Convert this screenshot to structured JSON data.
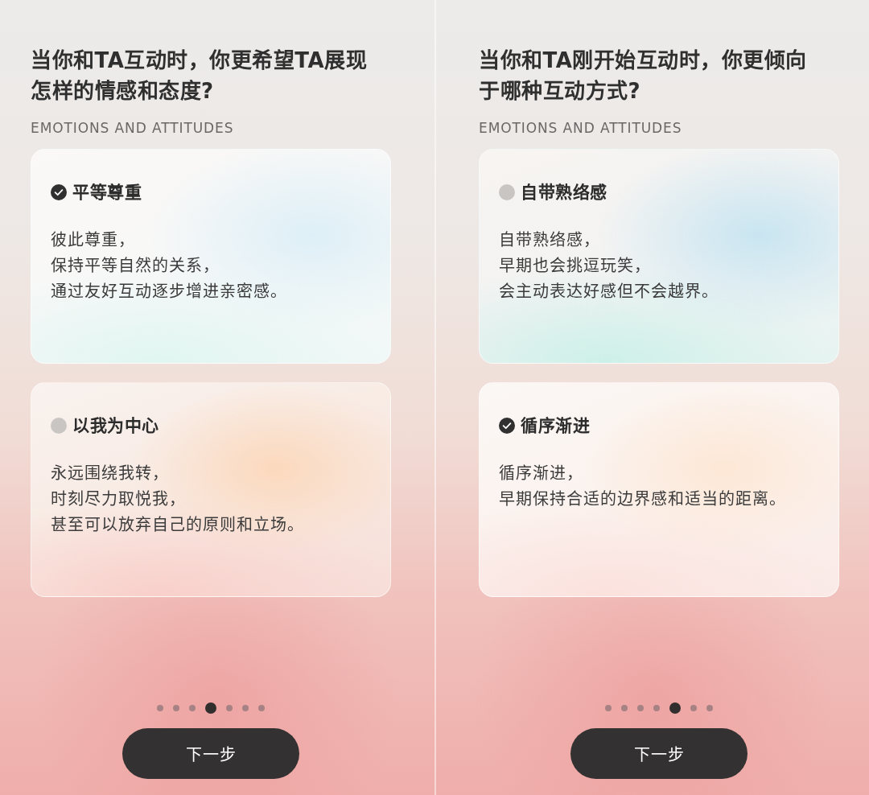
{
  "screens": [
    {
      "question": "当你和TA互动时，你更希望TA展现怎样的情感和态度?",
      "subtitle": "EMOTIONS AND ATTITUDES",
      "options": [
        {
          "title": "平等尊重",
          "description": [
            "彼此尊重，",
            "保持平等自然的关系，",
            "通过友好互动逐步增进亲密感。"
          ],
          "selected": true
        },
        {
          "title": "以我为中心",
          "description": [
            "永远围绕我转，",
            "时刻尽力取悦我，",
            "甚至可以放弃自己的原则和立场。"
          ],
          "selected": false
        }
      ],
      "pager": [
        {
          "selected": false
        },
        {
          "selected": false
        },
        {
          "selected": false
        },
        {
          "selected": true
        },
        {
          "selected": false
        },
        {
          "selected": false
        },
        {
          "selected": false
        }
      ],
      "button": "下一步"
    },
    {
      "question": "当你和TA刚开始互动时，你更倾向于哪种互动方式?",
      "subtitle": "EMOTIONS AND ATTITUDES",
      "options": [
        {
          "title": "自带熟络感",
          "description": [
            "自带熟络感，",
            "早期也会挑逗玩笑，",
            "会主动表达好感但不会越界。"
          ],
          "selected": false
        },
        {
          "title": "循序渐进",
          "description": [
            "循序渐进，",
            "早期保持合适的边界感和适当的距离。"
          ],
          "selected": true
        }
      ],
      "pager": [
        {
          "selected": false
        },
        {
          "selected": false
        },
        {
          "selected": false
        },
        {
          "selected": false
        },
        {
          "selected": true
        },
        {
          "selected": false
        },
        {
          "selected": false
        }
      ],
      "button": "下一步"
    }
  ]
}
